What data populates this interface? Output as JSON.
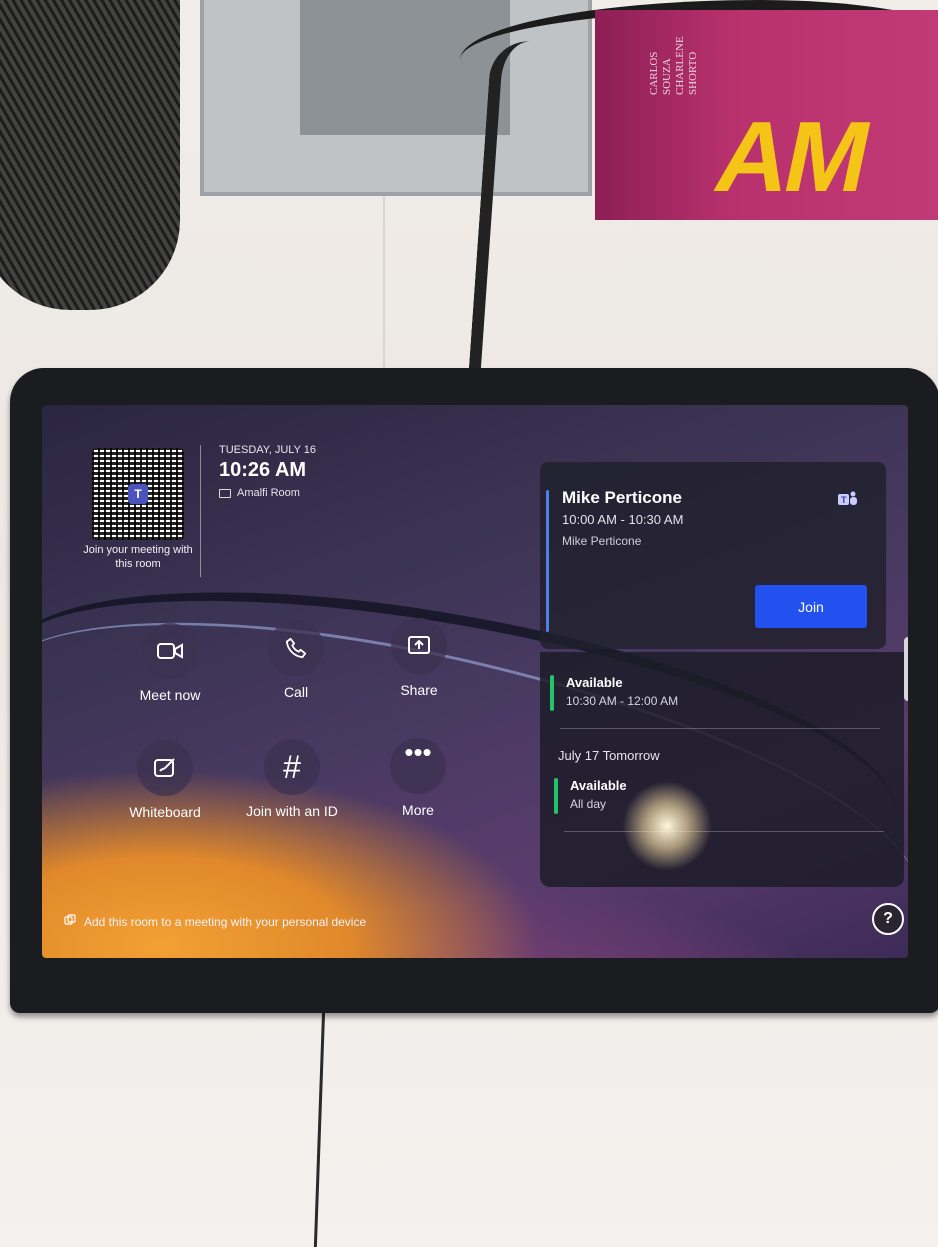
{
  "qr": {
    "caption": "Join your meeting with this room",
    "logo_letter": "T"
  },
  "header": {
    "date": "TUESDAY, JULY 16",
    "time": "10:26 AM",
    "room": "Amalfi Room"
  },
  "actions": [
    {
      "label": "Meet now",
      "icon": "video-camera-icon"
    },
    {
      "label": "Call",
      "icon": "phone-icon"
    },
    {
      "label": "Share",
      "icon": "share-screen-icon"
    },
    {
      "label": "Whiteboard",
      "icon": "whiteboard-icon"
    },
    {
      "label": "Join with an ID",
      "icon": "hash-icon"
    },
    {
      "label": "More",
      "icon": "more-dots-icon"
    }
  ],
  "meeting": {
    "title": "Mike Perticone",
    "time": "10:00 AM - 10:30 AM",
    "organizer": "Mike Perticone",
    "join_label": "Join",
    "accent": "#4e7fe7",
    "button_color": "#2351f0"
  },
  "schedule": {
    "today_slot": {
      "title": "Available",
      "subtitle": "10:30 AM - 12:00 AM"
    },
    "next_day_heading": "July 17 Tomorrow",
    "next_day_slot": {
      "title": "Available",
      "subtitle": "All day"
    },
    "available_color": "#23c36a"
  },
  "footer": {
    "text": "Add this room to a meeting with your personal device"
  },
  "help": {
    "label": "?"
  },
  "book": {
    "author_lines": "CARLOS SOUZA CHARLENE SHORTO",
    "title_fragment": "AM"
  }
}
